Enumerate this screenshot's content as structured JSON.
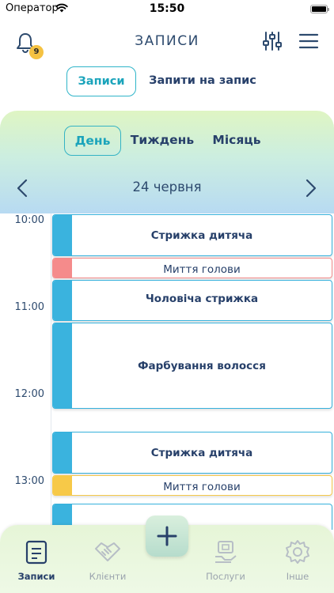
{
  "status_bar": {
    "carrier": "Оператор",
    "time": "15:50"
  },
  "header": {
    "title": "ЗАПИСИ",
    "notification_count": "9"
  },
  "top_tabs": [
    {
      "label": "Записи"
    },
    {
      "label": "Запити на запис"
    }
  ],
  "view_tabs": [
    {
      "label": "День"
    },
    {
      "label": "Тиждень"
    },
    {
      "label": "Місяць"
    }
  ],
  "date": "24 червня",
  "hours": [
    "10:00",
    "11:00",
    "12:00",
    "13:00"
  ],
  "appointments": [
    {
      "title": "Стрижка дитяча",
      "color": "#3ab3de"
    },
    {
      "title": "Миття голови",
      "color": "#f58b8b"
    },
    {
      "title": "Чоловіча стрижка",
      "color": "#3ab3de"
    },
    {
      "title": "Фарбування волосся",
      "color": "#3ab3de"
    },
    {
      "title": "Стрижка дитяча",
      "color": "#3ab3de"
    },
    {
      "title": "Миття голови",
      "color": "#f7c948"
    }
  ],
  "bottom_nav": [
    {
      "label": "Записи",
      "icon": "calendar-note-icon"
    },
    {
      "label": "Клієнти",
      "icon": "handshake-icon"
    },
    {
      "label": "Послуги",
      "icon": "services-box-icon"
    },
    {
      "label": "Інше",
      "icon": "gear-icon"
    }
  ],
  "colors": {
    "accent": "#1ba4bb",
    "text": "#27406a",
    "badge": "#f5c242"
  }
}
